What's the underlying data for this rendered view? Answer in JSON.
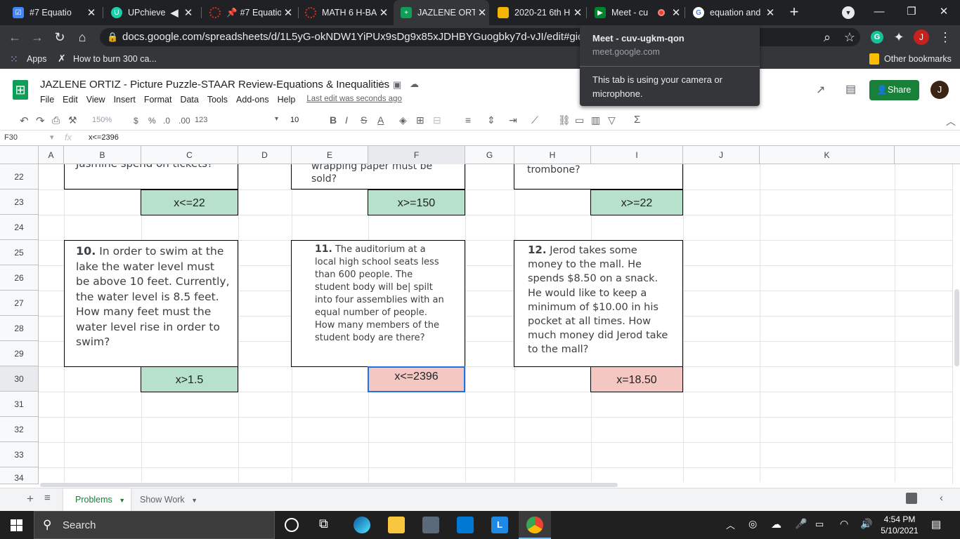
{
  "browser": {
    "tabs": [
      {
        "title": "#7 Equatio",
        "color": "#4285f4"
      },
      {
        "title": "UPchieve",
        "color": "#16d2aa"
      },
      {
        "title": "#7 Equatio",
        "color": "#d93025"
      },
      {
        "title": "MATH 6 H-BA",
        "color": "#d93025"
      },
      {
        "title": "JAZLENE ORTI",
        "color": "#0f9d58"
      },
      {
        "title": "2020-21 6th H",
        "color": "#f4b400"
      },
      {
        "title": "Meet - cu",
        "color": "#00832d"
      },
      {
        "title": "equation and",
        "color": "#4285f4"
      }
    ],
    "url": "docs.google.com/spreadsheets/d/1L5yG-okNDW1YiPUx9sDg9x85xJDHBYGuogbky7d-vJI/edit#gid=66256",
    "bookmarks": [
      "Apps",
      "How to burn 300 ca..."
    ],
    "other_bookmarks": "Other bookmarks",
    "profile_initial": "J"
  },
  "popup": {
    "title": "Meet - cuv-ugkm-qon",
    "domain": "meet.google.com",
    "message": "This tab is using your camera or microphone."
  },
  "sheet": {
    "doc_title": "JAZLENE ORTIZ - Picture Puzzle-STAAR Review-Equations & Inequalities",
    "menu": [
      "File",
      "Edit",
      "View",
      "Insert",
      "Format",
      "Data",
      "Tools",
      "Add-ons",
      "Help"
    ],
    "last_edit": "Last edit was seconds ago",
    "share": "Share",
    "zoom": "150%",
    "currency": "$",
    "percent": "%",
    "dec_dec": ".0",
    "dec_inc": ".00",
    "more_formats": "123",
    "font_size": "10",
    "cell_ref": "F30",
    "fx": "fx",
    "formula": "x<=2396",
    "columns": [
      "A",
      "B",
      "C",
      "D",
      "E",
      "F",
      "G",
      "H",
      "I",
      "J",
      "K"
    ],
    "rows": [
      "22",
      "23",
      "24",
      "25",
      "26",
      "27",
      "28",
      "29",
      "30",
      "31",
      "32",
      "33",
      "34"
    ],
    "top_texts": {
      "left": "Jasmine spend on tickets?",
      "mid": "wrapping paper must be sold?",
      "right": "trombone?"
    },
    "answers_top": [
      "x<=22",
      "x>=150",
      "x>=22"
    ],
    "problems": [
      {
        "num": "10.",
        "text": "In order to swim at the lake the water level must be above 10 feet. Currently, the water level is 8.5 feet.  How many feet must the water level rise in order to swim?"
      },
      {
        "num": "11.",
        "text": "The auditorium at a local high school seats less than 600 people.  The student body will be| spilt into four assemblies with an equal number of people. How many members of the student body are there?"
      },
      {
        "num": "12.",
        "text": "Jerod takes some money to the mall.  He spends $8.50 on a snack.  He would like to keep a minimum of $10.00 in his pocket at all times.  How much money did Jerod take to the mall?"
      }
    ],
    "answers_bottom": [
      "x>1.5",
      "x<=2396",
      "x=18.50"
    ],
    "sheet_tabs": [
      "Problems",
      "Show Work"
    ]
  },
  "taskbar": {
    "search": "Search",
    "time": "4:54 PM",
    "date": "5/10/2021"
  }
}
